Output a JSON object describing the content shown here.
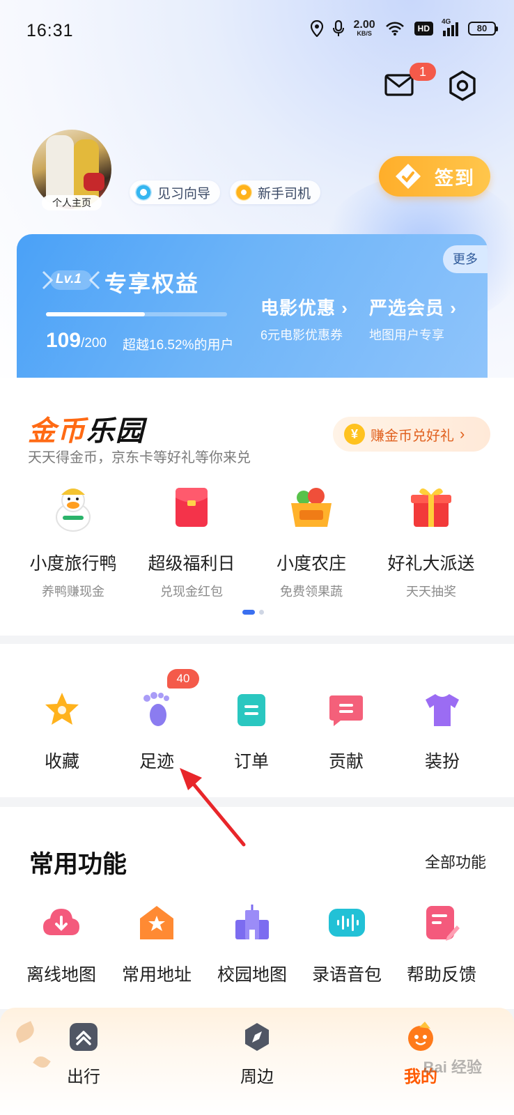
{
  "status_bar": {
    "time": "16:31",
    "speed_value": "2.00",
    "speed_unit": "KB/S",
    "hd": "HD",
    "net": "4G",
    "battery": "80"
  },
  "header": {
    "mail_badge": "1"
  },
  "profile": {
    "avatar_label": "个人主页",
    "tags": [
      "见习向导",
      "新手司机"
    ],
    "checkin_label": "签到"
  },
  "benefits": {
    "more": "更多",
    "level": "Lv.1",
    "title": "专享权益",
    "progress_fraction": 0.545,
    "score": "109",
    "score_total": "/200",
    "surpass": "超越16.52%的用户",
    "perks": [
      {
        "title": "电影优惠",
        "desc": "6元电影优惠券"
      },
      {
        "title": "严选会员",
        "desc": "地图用户专享"
      }
    ]
  },
  "coin_park": {
    "title_part1": "金币",
    "title_part2": "乐园",
    "subtitle": "天天得金币，京东卡等好礼等你来兑",
    "redeem_button": "赚金币兑好礼",
    "coin_symbol": "¥",
    "games": [
      {
        "name": "小度旅行鸭",
        "desc": "养鸭赚现金",
        "icon": "duck-icon"
      },
      {
        "name": "超级福利日",
        "desc": "兑现金红包",
        "icon": "red-envelope-icon"
      },
      {
        "name": "小度农庄",
        "desc": "免费领果蔬",
        "icon": "fruit-basket-icon"
      },
      {
        "name": "好礼大派送",
        "desc": "天天抽奖",
        "icon": "gift-box-icon"
      }
    ]
  },
  "quick_row": {
    "items": [
      {
        "label": "收藏",
        "icon": "star-icon"
      },
      {
        "label": "足迹",
        "icon": "footprint-icon",
        "badge": "40"
      },
      {
        "label": "订单",
        "icon": "order-icon"
      },
      {
        "label": "贡献",
        "icon": "contribution-icon"
      },
      {
        "label": "装扮",
        "icon": "tshirt-icon"
      }
    ]
  },
  "common_features": {
    "title": "常用功能",
    "all": "全部功能",
    "items": [
      {
        "label": "离线地图",
        "icon": "cloud-download-icon"
      },
      {
        "label": "常用地址",
        "icon": "home-star-icon"
      },
      {
        "label": "校园地图",
        "icon": "campus-icon"
      },
      {
        "label": "录语音包",
        "icon": "voice-wave-icon"
      },
      {
        "label": "帮助反馈",
        "icon": "feedback-edit-icon"
      }
    ]
  },
  "bottom_nav": {
    "items": [
      {
        "label": "出行",
        "icon": "travel-icon"
      },
      {
        "label": "周边",
        "icon": "compass-icon"
      },
      {
        "label": "我的",
        "icon": "mascot-icon",
        "active": true
      }
    ],
    "watermark": "Bai 经验"
  },
  "colors": {
    "accent_orange": "#ff5a00",
    "badge_red": "#f45a4a",
    "benefit_blue": "#4aa1f7"
  }
}
